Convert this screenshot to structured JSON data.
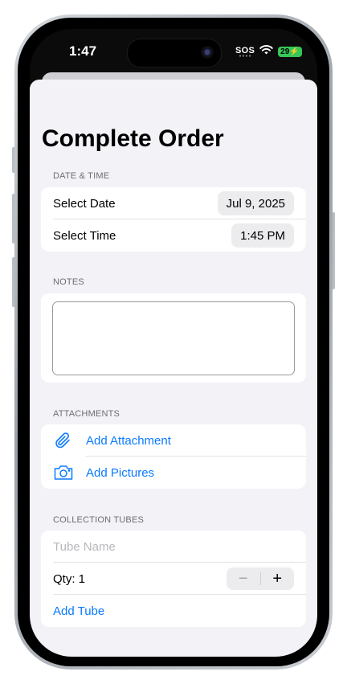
{
  "status_bar": {
    "time": "1:47",
    "sos": "SOS",
    "battery": "29"
  },
  "page_title": "Complete Order",
  "date_time": {
    "header": "DATE & TIME",
    "date_label": "Select Date",
    "date_value": "Jul 9, 2025",
    "time_label": "Select Time",
    "time_value": "1:45 PM"
  },
  "notes": {
    "header": "NOTES",
    "value": ""
  },
  "attachments": {
    "header": "ATTACHMENTS",
    "add_attachment": "Add Attachment",
    "add_pictures": "Add Pictures"
  },
  "collection_tubes": {
    "header": "COLLECTION TUBES",
    "tube_name_placeholder": "Tube Name",
    "qty_label": "Qty: 1",
    "minus": "−",
    "plus": "+",
    "add_tube": "Add Tube"
  },
  "colors": {
    "accent": "#0a7aff",
    "background": "#f2f2f7",
    "battery": "#34c759"
  }
}
